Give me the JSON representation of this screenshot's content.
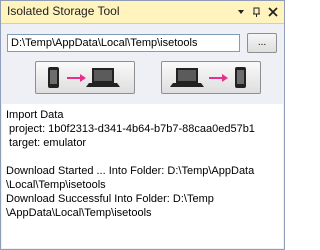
{
  "window": {
    "title": "Isolated Storage Tool"
  },
  "toolbar": {
    "path_value": "D:\\Temp\\AppData\\Local\\Temp\\isetools",
    "browse_label": "..."
  },
  "log": {
    "lines": [
      "Import Data",
      " project: 1b0f2313-d341-4b64-b7b7-88caa0ed57b1",
      " target: emulator",
      "",
      "Download Started ... Into Folder: D:\\Temp\\AppData",
      "\\Local\\Temp\\isetools",
      "Download Successful Into Folder: D:\\Temp",
      "\\AppData\\Local\\Temp\\isetools"
    ]
  },
  "colors": {
    "titlebar": "#fff4bd",
    "arrow": "#e8308a",
    "device": "#222222"
  },
  "icons": {
    "download_button": [
      "phone-icon",
      "arrow-right-icon",
      "laptop-icon"
    ],
    "upload_button": [
      "laptop-icon",
      "arrow-right-icon",
      "phone-icon"
    ]
  }
}
